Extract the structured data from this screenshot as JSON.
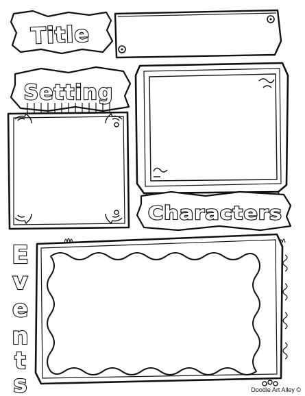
{
  "worksheet": {
    "title_label": "Title",
    "setting_label": "Setting",
    "characters_label": "Characters",
    "events_letters": [
      "E",
      "v",
      "e",
      "n",
      "t",
      "s"
    ]
  },
  "footer": {
    "credit": "Doodle Art Alley ©"
  },
  "colors": {
    "ink": "#111111",
    "paper": "#ffffff"
  }
}
